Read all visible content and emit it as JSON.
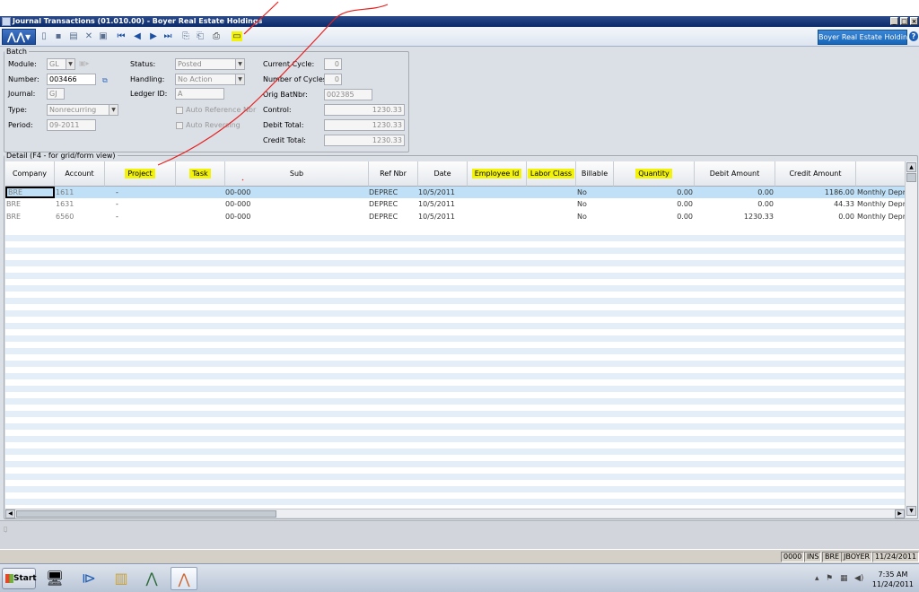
{
  "window": {
    "title": "Journal Transactions (01.010.00) - Boyer Real Estate Holdings",
    "min": "_",
    "max": "□",
    "close": "×"
  },
  "toolbar": {
    "company": "Boyer Real Estate Holdings",
    "help": "?"
  },
  "batch": {
    "legend": "Batch",
    "module_label": "Module:",
    "module_value": "GL",
    "number_label": "Number:",
    "number_value": "003466",
    "journal_label": "Journal:",
    "journal_value": "GJ",
    "type_label": "Type:",
    "type_value": "Nonrecurring",
    "period_label": "Period:",
    "period_value": "09-2011",
    "status_label": "Status:",
    "status_value": "Posted",
    "handling_label": "Handling:",
    "handling_value": "No Action",
    "ledger_label": "Ledger ID:",
    "ledger_value": "A",
    "auto_ref_label": "Auto Reference Nbr",
    "auto_rev_label": "Auto Reversing",
    "current_cycle_label": "Current Cycle:",
    "current_cycle_value": "0",
    "num_cycles_label": "Number of Cycles:",
    "num_cycles_value": "0",
    "orig_batnbr_label": "Orig BatNbr:",
    "orig_batnbr_value": "002385",
    "control_label": "Control:",
    "control_value": "1230.33",
    "debit_total_label": "Debit Total:",
    "debit_total_value": "1230.33",
    "credit_total_label": "Credit Total:",
    "credit_total_value": "1230.33"
  },
  "detail": {
    "legend": "Detail (F4 - for grid/form view)",
    "columns": [
      "Company",
      "Account",
      "Project",
      "Task",
      "Sub",
      "Ref Nbr",
      "Date",
      "Employee Id",
      "Labor Class",
      "Billable",
      "Quantity",
      "Debit Amount",
      "Credit Amount"
    ],
    "rows": [
      {
        "company": "BRE",
        "account": "1611",
        "project": "-",
        "sub": "00-000",
        "ref": "DEPREC",
        "date": "10/5/2011",
        "billable": "No",
        "quantity": "0.00",
        "debit": "0.00",
        "credit": "1186.00",
        "desc": "Monthly Deprec"
      },
      {
        "company": "BRE",
        "account": "1631",
        "project": "-",
        "sub": "00-000",
        "ref": "DEPREC",
        "date": "10/5/2011",
        "billable": "No",
        "quantity": "0.00",
        "debit": "0.00",
        "credit": "44.33",
        "desc": "Monthly Deprec"
      },
      {
        "company": "BRE",
        "account": "6560",
        "project": "-",
        "sub": "00-000",
        "ref": "DEPREC",
        "date": "10/5/2011",
        "billable": "No",
        "quantity": "0.00",
        "debit": "1230.33",
        "credit": "0.00",
        "desc": "Monthly Deprec"
      }
    ]
  },
  "status_bar": {
    "cells": [
      "0000",
      "INS",
      "BRE",
      "JBOYER",
      "11/24/2011"
    ]
  },
  "taskbar": {
    "start": "Start",
    "time": "7:35 AM",
    "date": "11/24/2011"
  },
  "colors": {
    "highlight": "#f3f20a",
    "annotation": "#e8201e",
    "titlebar": "#0a2a6a",
    "selected_row": "#bfe0f6"
  }
}
